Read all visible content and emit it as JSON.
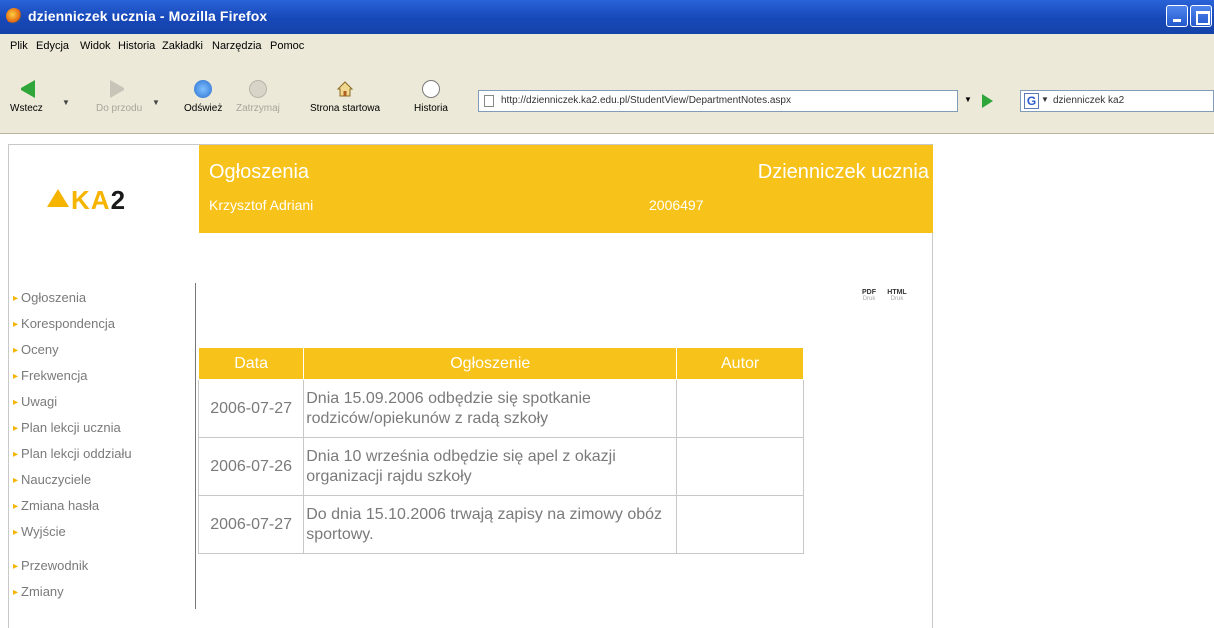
{
  "window": {
    "title": "dzienniczek ucznia - Mozilla Firefox"
  },
  "menu": [
    "Plik",
    "Edycja",
    "Widok",
    "Historia",
    "Zakładki",
    "Narzędzia",
    "Pomoc"
  ],
  "toolbar": {
    "back": "Wstecz",
    "forward": "Do przodu",
    "reload": "Odśwież",
    "stop": "Zatrzymaj",
    "home": "Strona startowa",
    "history": "Historia",
    "url": "http://dzienniczek.ka2.edu.pl/StudentView/DepartmentNotes.aspx",
    "search": "dzienniczek ka2"
  },
  "header": {
    "logo_letters": "KA",
    "logo_number": "2",
    "title": "Ogłoszenia",
    "app_name": "Dzienniczek ucznia",
    "user_name": "Krzysztof Adriani",
    "user_id": "2006497"
  },
  "nav": {
    "main": [
      "Ogłoszenia",
      "Korespondencja",
      "Oceny",
      "Frekwencja",
      "Uwagi",
      "Plan lekcji ucznia",
      "Plan lekcji oddziału",
      "Nauczyciele",
      "Zmiana hasła",
      "Wyjście"
    ],
    "extra": [
      "Przewodnik",
      "Zmiany"
    ]
  },
  "exports": [
    {
      "label": "PDF",
      "sub": "Druk"
    },
    {
      "label": "HTML",
      "sub": "Druk"
    }
  ],
  "table": {
    "headers": [
      "Data",
      "Ogłoszenie",
      "Autor"
    ],
    "rows": [
      {
        "date": "2006-07-27",
        "text": "Dnia 15.09.2006 odbędzie się spotkanie rodziców/opiekunów z radą szkoły",
        "author": ""
      },
      {
        "date": "2006-07-26",
        "text": "Dnia 10 września odbędzie się apel z okazji organizacji rajdu szkoły",
        "author": ""
      },
      {
        "date": "2006-07-27",
        "text": "Do dnia 15.10.2006 trwają zapisy na zimowy obóz sportowy.",
        "author": ""
      }
    ]
  }
}
